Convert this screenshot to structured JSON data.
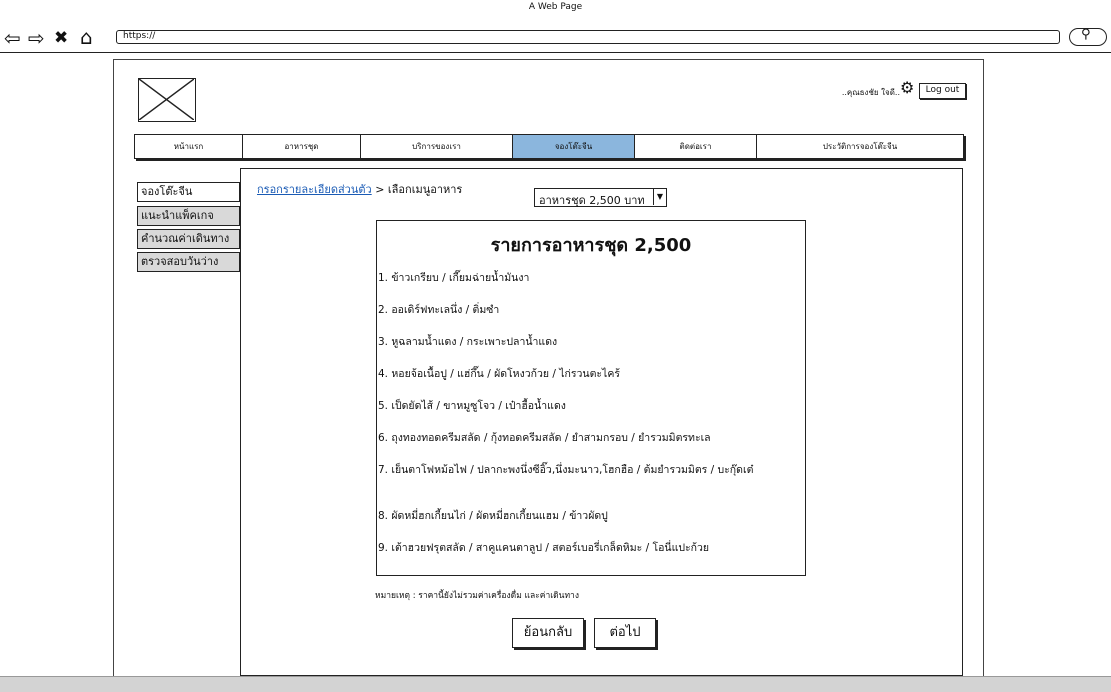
{
  "browser": {
    "title": "A Web Page",
    "url": "https://",
    "icons": [
      "back-arrow-icon",
      "forward-arrow-icon",
      "close-icon",
      "home-icon",
      "search-icon"
    ]
  },
  "header": {
    "greeting": "..คุณธงชัย ใจดี..",
    "logout_label": "Log out"
  },
  "nav": {
    "tabs": [
      {
        "label": "หน้าแรก",
        "active": false
      },
      {
        "label": "อาหารชุด",
        "active": false
      },
      {
        "label": "บริการของเรา",
        "active": false
      },
      {
        "label": "จองโต๊ะจีน",
        "active": true
      },
      {
        "label": "ติดต่อเรา",
        "active": false
      },
      {
        "label": "ประวัติการจองโต๊ะจีน",
        "active": false
      }
    ]
  },
  "sidebar": {
    "items": [
      {
        "label": "จองโต๊ะจีน",
        "active": true
      },
      {
        "label": "แนะนำแพ็คเกจ",
        "active": false
      },
      {
        "label": "คำนวณค่าเดินทาง",
        "active": false
      },
      {
        "label": "ตรวจสอบวันว่าง",
        "active": false
      }
    ]
  },
  "breadcrumb": {
    "link": "กรอกรายละเอียดส่วนตัว",
    "separator": " > ",
    "current": "เลือกเมนูอาหาร"
  },
  "package_select": {
    "value": "อาหารชุด 2,500 บาท"
  },
  "menu": {
    "title": "รายการอาหารชุด 2,500",
    "items": [
      "1. ข้าวเกรียบ / เกี๊ยมฉ่ายน้ำมันงา",
      "2. ออเดิร์ฟทะเลนึ่ง / ติ่มซำ",
      "3. หูฉลามน้ำแดง / กระเพาะปลาน้ำแดง",
      "4. หอยจ้อเนื้อปู / แฮ่กึ๊น / ผัดโหงวก้วย / ไก่รวนตะไคร้",
      "5. เป็ดยัดไส้ / ขาหมูซูโจว / เป๋าฮื้อน้ำแดง",
      "6. ถุงทองทอดครีมสลัด / กุ้งทอดครีมสลัด / ยำสามกรอบ / ยำรวมมิตรทะเล",
      "7. เย็นตาโฟหม้อไฟ / ปลากะพงนึ่งซีอิ๊ว,นึ่งมะนาว,โฮกฮือ / ต้มยำรวมมิตร / บะกุ๊ดเต๋",
      "8. ผัดหมี่ฮกเกี้ยนไก่ / ผัดหมี่ฮกเกี้ยนแฮม / ข้าวผัดปู",
      "9. เต้าฮวยฟรุตสลัด / สาคูแคนตาลูป / สตอร์เบอรี่เกล็ดหิมะ / โอนี่แปะก้วย"
    ]
  },
  "note": "หมายเหตุ : ราคานี้ยังไม่รวมค่าเครื่องดื่ม และค่าเดินทาง",
  "buttons": {
    "back": "ย้อนกลับ",
    "next": "ต่อไป"
  },
  "colors": {
    "active_tab": "#8bb6dd",
    "link": "#1a5bb5",
    "sidebar_bg": "#d9d9d9"
  }
}
